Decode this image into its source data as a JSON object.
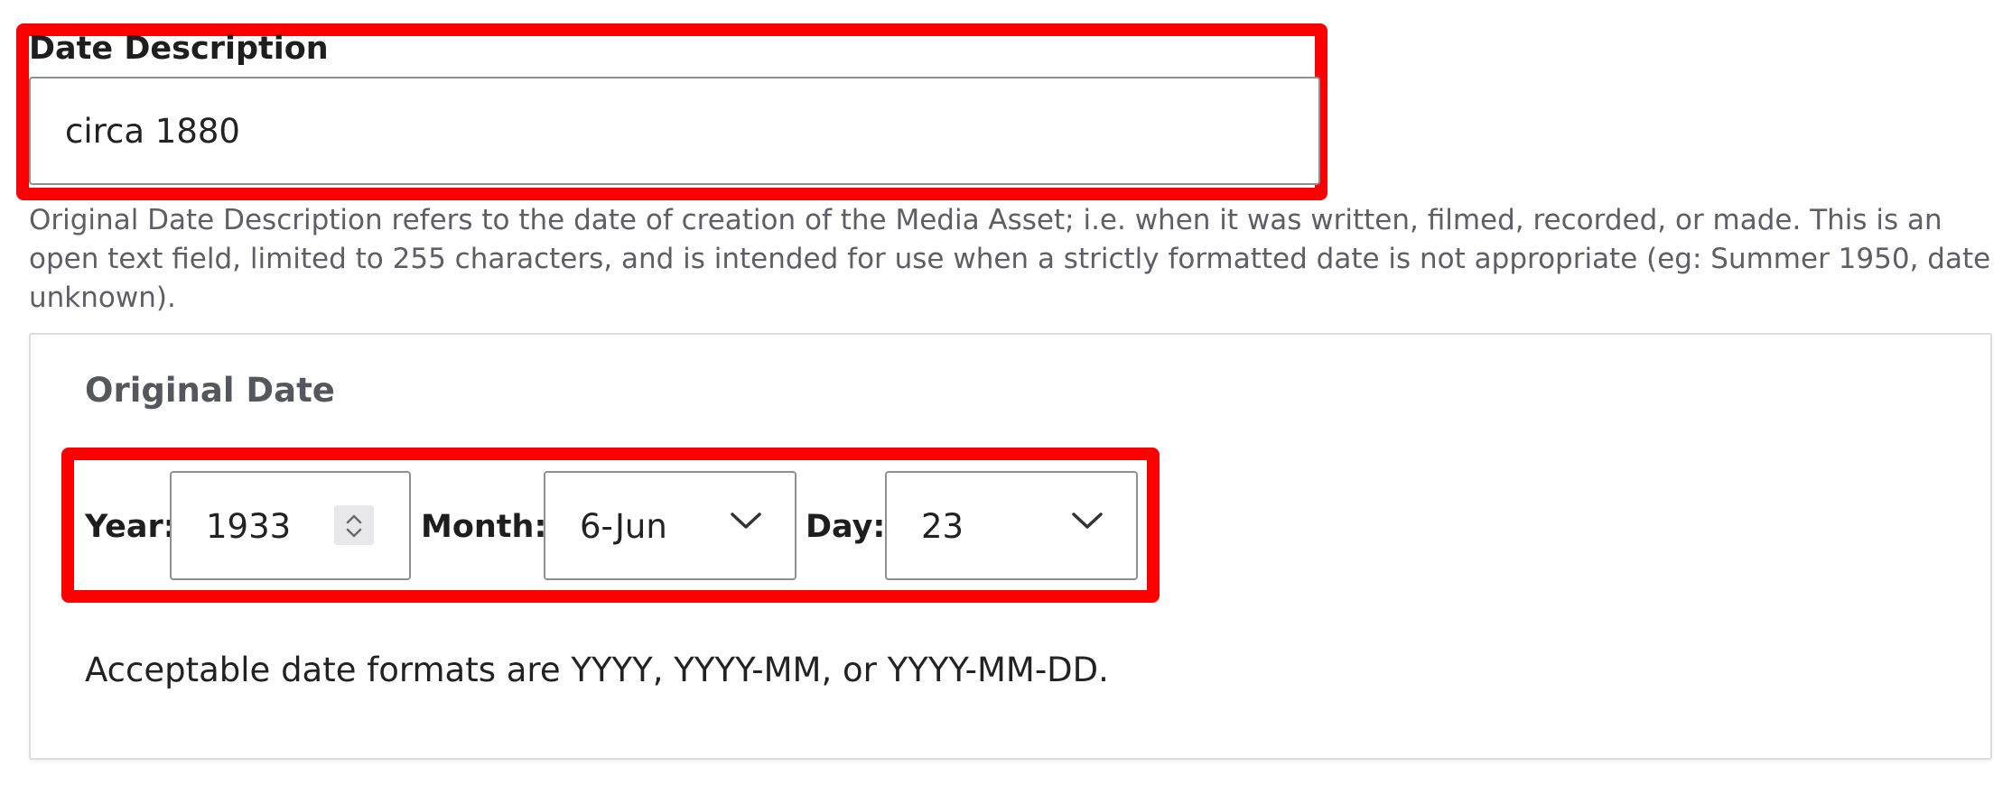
{
  "date_description": {
    "label": "Date Description",
    "value": "circa 1880",
    "help_text": "Original Date Description refers to the date of creation of the Media Asset; i.e. when it was written, filmed, recorded, or made. This is an open text field, limited to 255 characters, and is intended for use when a strictly formatted date is not appropriate (eg: Summer 1950, date unknown)."
  },
  "original_date": {
    "title": "Original Date",
    "year": {
      "label": "Year:",
      "value": "1933",
      "icon": "spinner-icon"
    },
    "month": {
      "label": "Month:",
      "value": "6-Jun",
      "icon": "chevron-down-icon"
    },
    "day": {
      "label": "Day:",
      "value": "23",
      "icon": "chevron-down-icon"
    },
    "note": "Acceptable date formats are YYYY, YYYY-MM, or YYYY-MM-DD."
  },
  "colors": {
    "highlight": "#ff0000",
    "border": "#8f8f8f",
    "panel_border": "#dddddd",
    "help_text": "#5e5e66",
    "panel_title": "#55575c"
  }
}
